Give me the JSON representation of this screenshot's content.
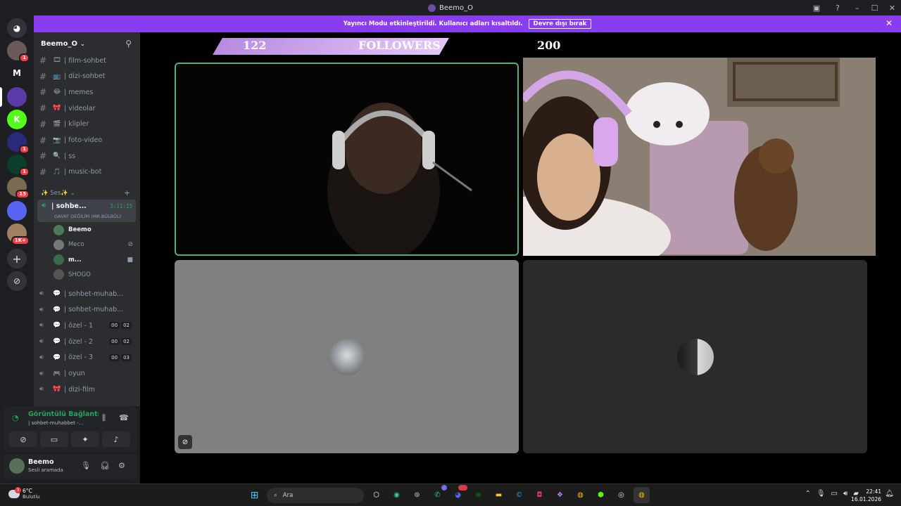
{
  "window": {
    "title": "Beemo_O"
  },
  "banner": {
    "text": "Yayıncı Modu etkinleştirildi. Kullanıcı adları kısaltıldı.",
    "button": "Devre dışı bırak"
  },
  "guilds": [
    {
      "name": "server-1",
      "color": "#6a5a5a",
      "badge": "1"
    },
    {
      "name": "server-m",
      "color": "#1e1f22",
      "letter": "M"
    },
    {
      "name": "server-purple",
      "color": "#5b3aa8"
    },
    {
      "name": "kick-server",
      "color": "#53fc18",
      "letter": "K"
    },
    {
      "name": "server-5",
      "color": "#2a2a7a",
      "badge": "1"
    },
    {
      "name": "server-6",
      "color": "#0d3d2b",
      "badge": "1"
    },
    {
      "name": "server-7",
      "color": "#7a6a50",
      "badge": "13"
    },
    {
      "name": "discord-bot",
      "color": "#5865f2"
    },
    {
      "name": "server-9",
      "color": "#a08060",
      "badge": "1K+"
    }
  ],
  "server": {
    "name": "Beemo_O"
  },
  "text_channels": [
    {
      "label": "| film-sohbet",
      "emoji": "🎞"
    },
    {
      "label": "| dizi-sohbet",
      "emoji": "📺"
    },
    {
      "label": "| memes",
      "emoji": "😂"
    },
    {
      "label": "| videolar",
      "emoji": "🎀"
    },
    {
      "label": "| klipler",
      "emoji": "🎬"
    },
    {
      "label": "| foto-video",
      "emoji": "📷"
    },
    {
      "label": "| ss",
      "emoji": "🔍"
    },
    {
      "label": "| music-bot",
      "emoji": "🎵"
    }
  ],
  "category": {
    "label": "✨ Ses✨"
  },
  "active_channel": {
    "name": "| sohbe...",
    "time": "3:11:15",
    "status": "GAVAT DEĞİLİM (MR.BÜLBÜL)"
  },
  "members": [
    {
      "name": "Beemo",
      "color": "#4c7a58",
      "bold": true
    },
    {
      "name": "Meco",
      "color": "#777"
    },
    {
      "name": "m...",
      "color": "#3a6a4a",
      "bold": true
    },
    {
      "name": "SHOGO",
      "color": "#555"
    }
  ],
  "voice_channels": [
    {
      "label": "| sohbet-muhab...",
      "counts": []
    },
    {
      "label": "| sohbet-muhab...",
      "counts": []
    },
    {
      "label": "| özel - 1",
      "counts": [
        "00",
        "02"
      ]
    },
    {
      "label": "| özel - 2",
      "counts": [
        "00",
        "02"
      ]
    },
    {
      "label": "| özel - 3",
      "counts": [
        "00",
        "03"
      ]
    },
    {
      "label": "| oyun",
      "counts": []
    },
    {
      "label": "| dizi-film",
      "counts": []
    }
  ],
  "voice_panel": {
    "title": "Görüntülü Bağlantı K",
    "sub": "| sohbet-muhabbet -..."
  },
  "user": {
    "name": "Beemo",
    "status": "Sesli aramada"
  },
  "stream_overlay": {
    "left_count": "122",
    "label": "FOLLOWERS",
    "right_count": "200"
  },
  "taskbar": {
    "weather_temp": "6°C",
    "weather_desc": "Bulutlu",
    "weather_badge": "3",
    "search": "Ara",
    "time": "22:41",
    "date": "16.01.2026",
    "whatsapp_badge": "2",
    "discord_badge": "9+"
  }
}
